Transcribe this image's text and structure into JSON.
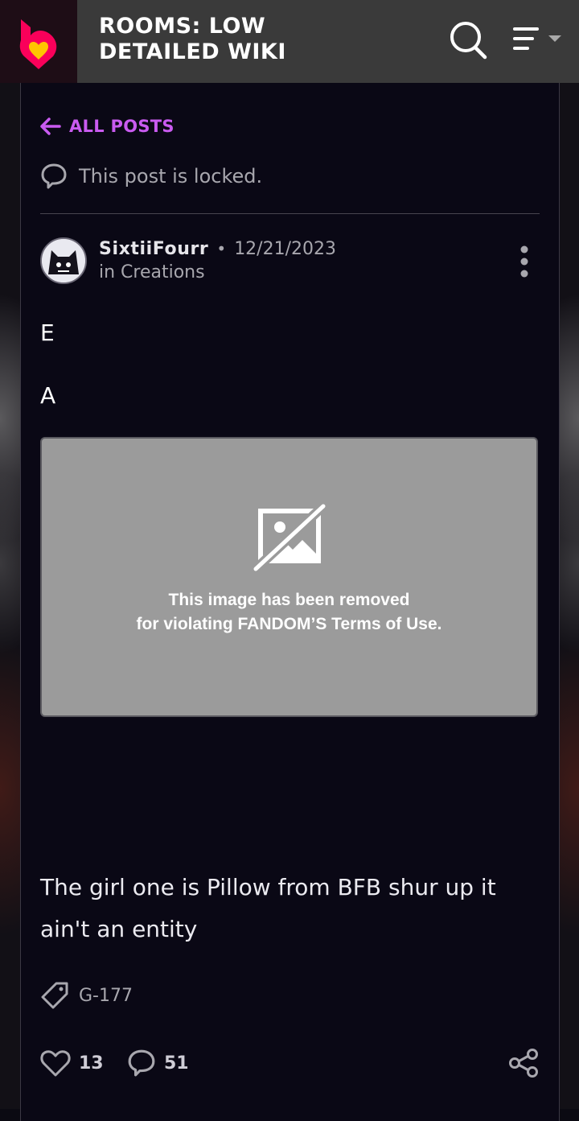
{
  "header": {
    "wiki_title": "ROOMS: LOW DETAILED WIKI",
    "logo_icon": "fandom-heart-flame-icon",
    "search_icon": "search-icon",
    "menu_icon": "hamburger-menu-icon"
  },
  "nav": {
    "back_label": "ALL POSTS"
  },
  "status": {
    "locked_text": "This post is locked."
  },
  "post": {
    "author": "SixtiiFourr",
    "separator": "•",
    "date": "12/21/2023",
    "category": "in Creations",
    "lines": [
      "E",
      "A"
    ],
    "removed_image": {
      "line1": "This image has been removed",
      "line2": "for violating FANDOM’S Terms of Use."
    },
    "text": "The girl one is Pillow from BFB shur up it ain't an entity",
    "tag": "G-177",
    "likes": "13",
    "replies": "51"
  },
  "colors": {
    "accent": "#c95bf0",
    "header_bg": "#3a3a3a",
    "card_bg": "#0a0815"
  }
}
